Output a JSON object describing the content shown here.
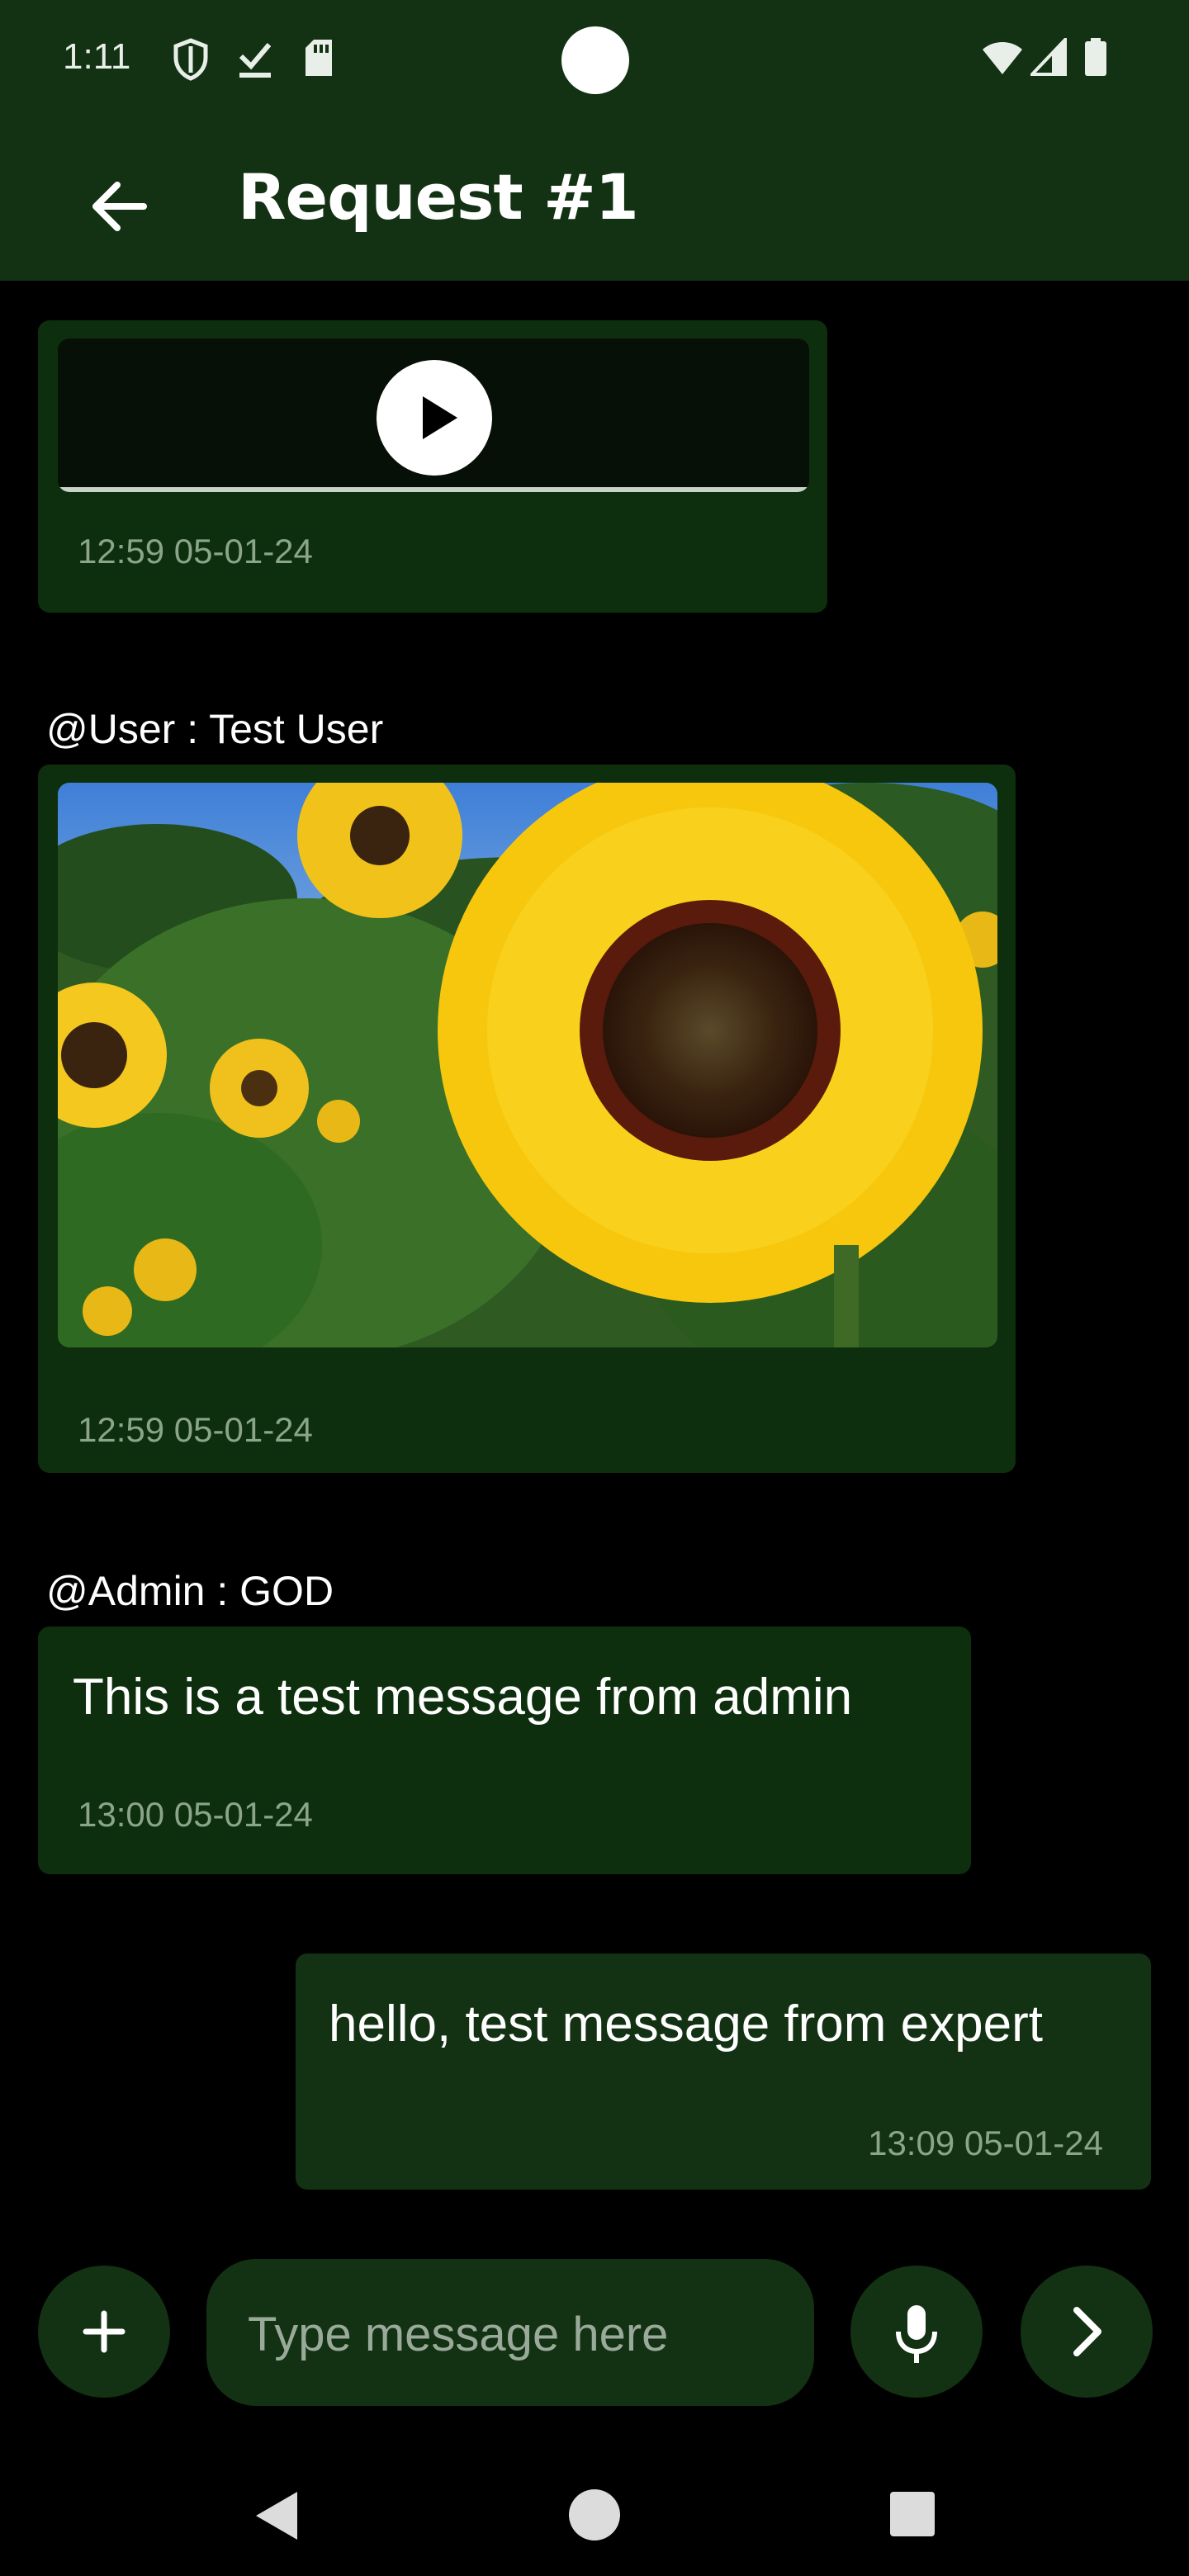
{
  "status_bar": {
    "time": "1:11",
    "left_icons": [
      "shield-icon",
      "download-done-icon",
      "sd-card-icon"
    ],
    "right_icons": [
      "wifi-icon",
      "cellular-signal-icon",
      "battery-icon"
    ]
  },
  "app_bar": {
    "title": "Request #1",
    "back_icon": "arrow-back-icon"
  },
  "messages": [
    {
      "type": "audio",
      "direction": "incoming",
      "time": "12:59 05-01-24"
    },
    {
      "type": "image",
      "direction": "incoming",
      "sender": "@User : Test User",
      "image_subject": "sunflower",
      "time": "12:59 05-01-24"
    },
    {
      "type": "text",
      "direction": "incoming",
      "sender": "@Admin : GOD",
      "text": "This is a test message from admin",
      "time": "13:00 05-01-24"
    },
    {
      "type": "text",
      "direction": "outgoing",
      "text": "hello, test message from expert",
      "time": "13:09 05-01-24"
    }
  ],
  "composer": {
    "placeholder": "Type message here",
    "add_icon": "plus-icon",
    "mic_icon": "microphone-icon",
    "send_icon": "chevron-right-icon"
  },
  "colors": {
    "app_bar": "#133113",
    "incoming_bubble": "#0d2f0d",
    "outgoing_bubble": "#133113",
    "background": "#000000"
  }
}
